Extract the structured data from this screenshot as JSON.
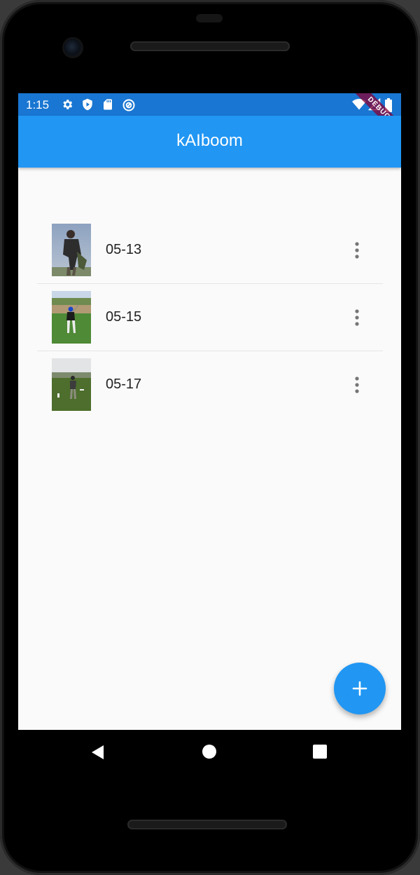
{
  "status_bar": {
    "time": "1:15",
    "left_icons": [
      "gear-icon",
      "shield-play-icon",
      "sd-card-icon",
      "at-sign-icon"
    ],
    "right_icons": [
      "wifi-icon",
      "signal-icon",
      "battery-icon"
    ],
    "color": "#1976d2"
  },
  "debug_banner": "DEBUG",
  "app_bar": {
    "title": "kAIboom",
    "color": "#2196f3"
  },
  "list": {
    "items": [
      {
        "label": "05-13",
        "thumbnail": "golfer-photo"
      },
      {
        "label": "05-15",
        "thumbnail": "golfer-photo"
      },
      {
        "label": "05-17",
        "thumbnail": "golfer-photo"
      }
    ]
  },
  "fab": {
    "icon": "plus-icon",
    "color": "#2196f3"
  },
  "nav_bar": {
    "buttons": [
      "back-icon",
      "home-icon",
      "recents-icon"
    ]
  }
}
